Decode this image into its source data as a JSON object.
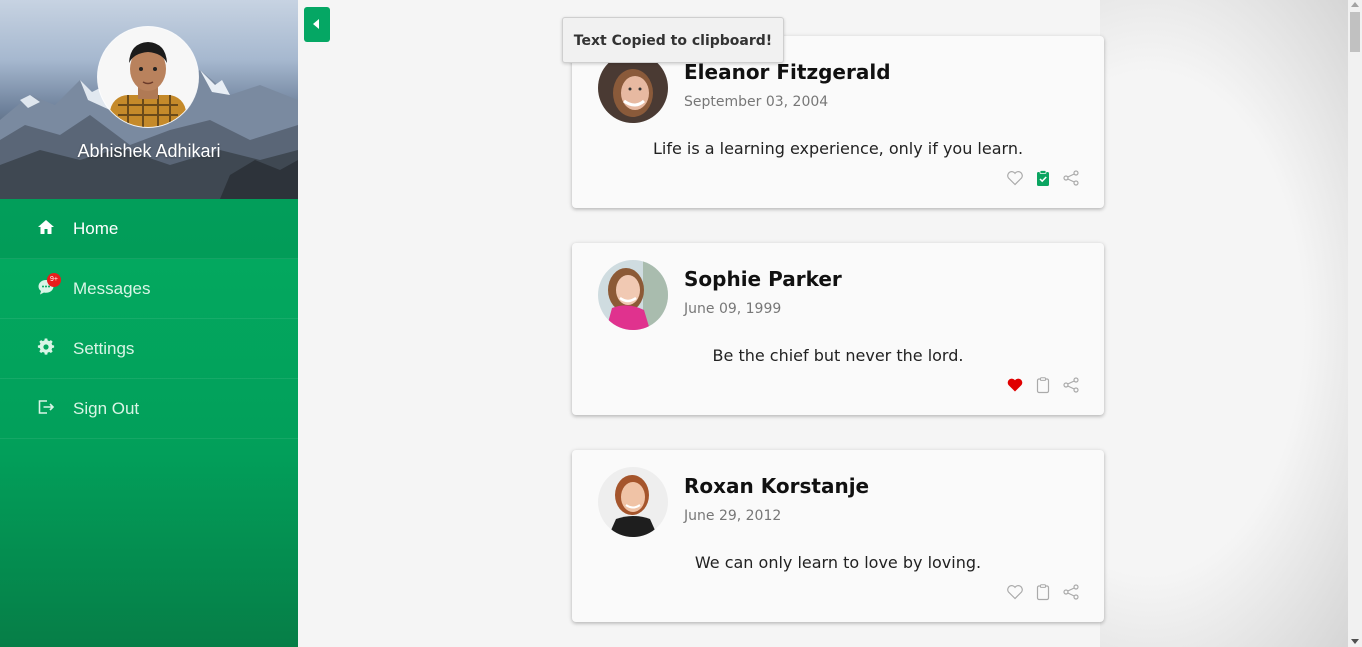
{
  "profile": {
    "name": "Abhishek Adhikari"
  },
  "nav": {
    "items": [
      {
        "label": "Home",
        "icon": "home-icon",
        "active": true
      },
      {
        "label": "Messages",
        "icon": "chat-icon",
        "badge": "9+"
      },
      {
        "label": "Settings",
        "icon": "gear-icon"
      },
      {
        "label": "Sign Out",
        "icon": "sign-out-icon"
      }
    ]
  },
  "toast": {
    "text": "Text Copied to clipboard!"
  },
  "cards": [
    {
      "name": "Eleanor Fitzgerald",
      "date": "September 03, 2004",
      "quote": "Life is a learning experience, only if you learn.",
      "liked": false,
      "copied": true
    },
    {
      "name": "Sophie Parker",
      "date": "June 09, 1999",
      "quote": "Be the chief but never the lord.",
      "liked": true,
      "copied": false
    },
    {
      "name": "Roxan Korstanje",
      "date": "June 29, 2012",
      "quote": "We can only learn to love by loving.",
      "liked": false,
      "copied": false
    }
  ],
  "colors": {
    "accent": "#03a85f",
    "like": "#e00000",
    "copied": "#0aa460",
    "badge": "#e81c1c"
  }
}
